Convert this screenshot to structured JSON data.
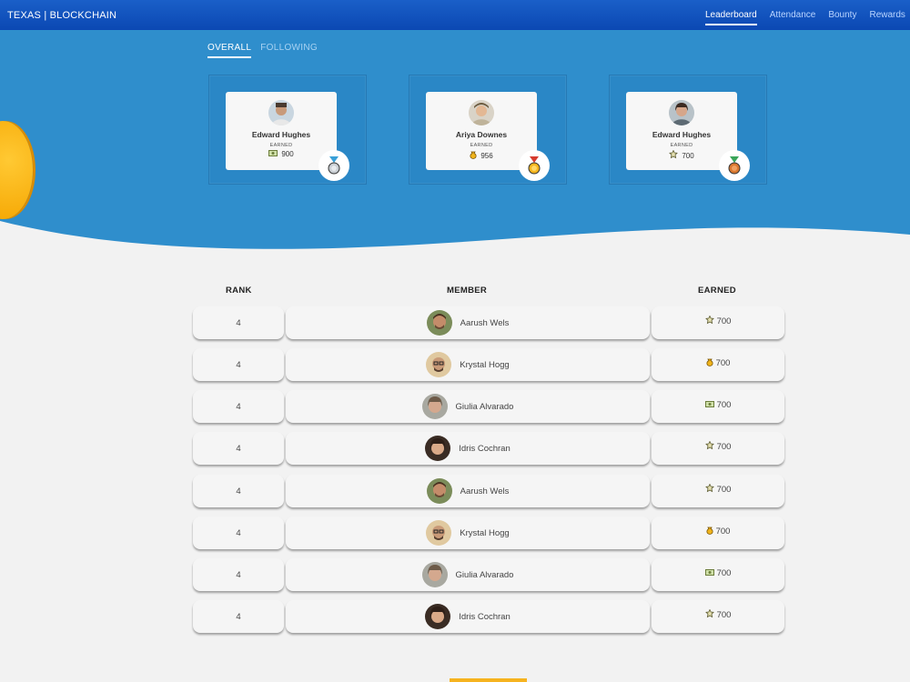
{
  "brand": "TEXAS | BLOCKCHAIN",
  "nav": [
    {
      "label": "Leaderboard",
      "active": true
    },
    {
      "label": "Attendance",
      "active": false
    },
    {
      "label": "Bounty",
      "active": false
    },
    {
      "label": "Rewards",
      "active": false
    }
  ],
  "tabs": [
    {
      "label": "OVERALL",
      "active": true
    },
    {
      "label": "FOLLOWING",
      "active": false
    }
  ],
  "podium": [
    {
      "name": "Edward Hughes",
      "label": "EARNED",
      "score": "900",
      "icon": "cash-icon",
      "medal": "silver-medal-icon",
      "avatar": "person-a"
    },
    {
      "name": "Ariya Downes",
      "label": "EARNED",
      "score": "956",
      "icon": "coin-bag-icon",
      "medal": "gold-medal-icon",
      "avatar": "person-b"
    },
    {
      "name": "Edward Hughes",
      "label": "EARNED",
      "score": "700",
      "icon": "badge-icon",
      "medal": "bronze-medal-icon",
      "avatar": "person-c"
    }
  ],
  "table": {
    "headers": {
      "rank": "RANK",
      "member": "MEMBER",
      "earned": "EARNED"
    },
    "rows": [
      {
        "rank": "4",
        "name": "Aarush Wels",
        "earned": "700",
        "icon": "badge-icon",
        "avatar": "person-d"
      },
      {
        "rank": "4",
        "name": "Krystal Hogg",
        "earned": "700",
        "icon": "coin-bag-icon",
        "avatar": "person-e"
      },
      {
        "rank": "4",
        "name": "Giulia Alvarado",
        "earned": "700",
        "icon": "cash-icon",
        "avatar": "person-f"
      },
      {
        "rank": "4",
        "name": "Idris Cochran",
        "earned": "700",
        "icon": "badge-icon",
        "avatar": "person-g"
      },
      {
        "rank": "4",
        "name": "Aarush Wels",
        "earned": "700",
        "icon": "badge-icon",
        "avatar": "person-d"
      },
      {
        "rank": "4",
        "name": "Krystal Hogg",
        "earned": "700",
        "icon": "coin-bag-icon",
        "avatar": "person-e"
      },
      {
        "rank": "4",
        "name": "Giulia Alvarado",
        "earned": "700",
        "icon": "cash-icon",
        "avatar": "person-f"
      },
      {
        "rank": "4",
        "name": "Idris Cochran",
        "earned": "700",
        "icon": "badge-icon",
        "avatar": "person-g"
      }
    ]
  },
  "colors": {
    "nav": "#0b48b3",
    "hero": "#2f8ecc",
    "background": "#f2f2f2",
    "accent": "#f6b31f"
  }
}
